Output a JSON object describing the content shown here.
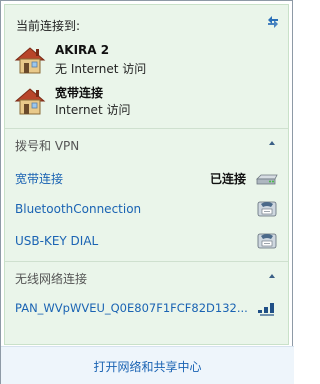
{
  "header": {
    "title": "当前连接到:",
    "connections": [
      {
        "name": "AKIRA  2",
        "access": "无 Internet 访问",
        "icon": "network-house-icon"
      },
      {
        "name": "宽带连接",
        "access": "Internet 访问",
        "icon": "network-house-icon"
      }
    ]
  },
  "dialup_section": {
    "title": "拨号和 VPN",
    "items": [
      {
        "name": "宽带连接",
        "status": "已连接",
        "icon": "broadband-modem-icon"
      },
      {
        "name": "BluetoothConnection",
        "status": "",
        "icon": "dialup-phone-icon"
      },
      {
        "name": "USB-KEY DIAL",
        "status": "",
        "icon": "dialup-phone-icon"
      }
    ]
  },
  "wireless_section": {
    "title": "无线网络连接",
    "items": [
      {
        "name": "PAN_WVpWVEU_Q0E807F1FCF82D132...",
        "icon": "signal-strength-icon"
      }
    ]
  },
  "footer": {
    "link": "打开网络和共享中心"
  }
}
